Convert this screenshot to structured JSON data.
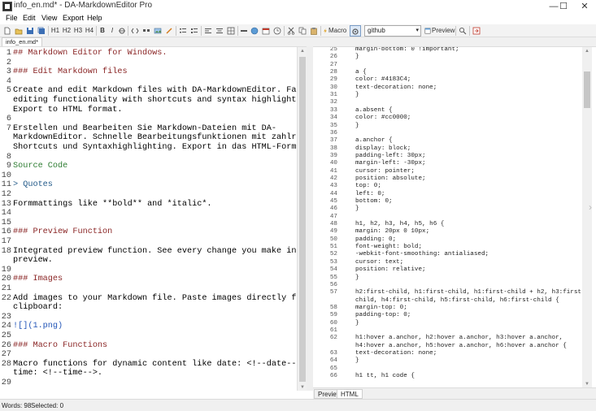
{
  "window": {
    "title": "info_en.md* - DA-MarkdownEditor Pro",
    "minimize": "—",
    "maximize": "☐",
    "close": "✕"
  },
  "menu": [
    "File",
    "Edit",
    "View",
    "Export",
    "Help"
  ],
  "toolbar": {
    "h1": "H1",
    "h2": "H2",
    "h3": "H3",
    "h4": "H4",
    "bold": "B",
    "italic": "I",
    "macro_label": "Macro",
    "style_value": "github",
    "preview_label": "Preview"
  },
  "document_tab": "info_en.md*",
  "editor_lines": [
    {
      "n": "1",
      "t": "## Markdown Editor for Windows.",
      "k": "h"
    },
    {
      "n": "2",
      "t": "",
      "k": ""
    },
    {
      "n": "3",
      "t": "### Edit Markdown files",
      "k": "h"
    },
    {
      "n": "4",
      "t": "",
      "k": ""
    },
    {
      "n": "5",
      "t": "Create and edit Markdown files with DA-MarkdownEditor. Fast",
      "k": ""
    },
    {
      "n": "",
      "t": "editing functionality with shortcuts and syntax highlighting.",
      "k": ""
    },
    {
      "n": "",
      "t": "Export to HTML format.",
      "k": ""
    },
    {
      "n": "6",
      "t": "",
      "k": ""
    },
    {
      "n": "7",
      "t": "Erstellen und Bearbeiten Sie Markdown-Dateien mit DA-",
      "k": ""
    },
    {
      "n": "",
      "t": "MarkdownEditor. Schnelle Bearbeitungsfunktionen mit zahlreichen",
      "k": ""
    },
    {
      "n": "",
      "t": "Shortcuts und Syntaxhighlighting. Export in das HTML-Format.",
      "k": ""
    },
    {
      "n": "8",
      "t": "",
      "k": ""
    },
    {
      "n": "9",
      "t": "    Source Code",
      "k": "src"
    },
    {
      "n": "10",
      "t": "",
      "k": ""
    },
    {
      "n": "11",
      "t": "> Quotes",
      "k": "q"
    },
    {
      "n": "12",
      "t": "",
      "k": ""
    },
    {
      "n": "13",
      "t": "Formmattings like **bold** and *italic*.",
      "k": ""
    },
    {
      "n": "14",
      "t": "",
      "k": ""
    },
    {
      "n": "15",
      "t": "",
      "k": ""
    },
    {
      "n": "16",
      "t": "### Preview Function",
      "k": "h"
    },
    {
      "n": "17",
      "t": "",
      "k": ""
    },
    {
      "n": "18",
      "t": "Integrated preview function. See every change you make in the",
      "k": ""
    },
    {
      "n": "",
      "t": "preview.",
      "k": ""
    },
    {
      "n": "19",
      "t": "",
      "k": ""
    },
    {
      "n": "20",
      "t": "### Images",
      "k": "h"
    },
    {
      "n": "21",
      "t": "",
      "k": ""
    },
    {
      "n": "22",
      "t": "Add images to your Markdown file. Paste images directly from the",
      "k": ""
    },
    {
      "n": "",
      "t": "clipboard:",
      "k": ""
    },
    {
      "n": "23",
      "t": "",
      "k": ""
    },
    {
      "n": "24",
      "t": "![](1.png)",
      "k": "link"
    },
    {
      "n": "25",
      "t": "",
      "k": ""
    },
    {
      "n": "26",
      "t": "### Macro Functions",
      "k": "h"
    },
    {
      "n": "27",
      "t": "",
      "k": ""
    },
    {
      "n": "28",
      "t": "Macro functions for dynamic content like date: <!--date--> or",
      "k": ""
    },
    {
      "n": "",
      "t": "time: <!--time-->.",
      "k": ""
    },
    {
      "n": "29",
      "t": "",
      "k": ""
    }
  ],
  "html_lines": [
    {
      "n": "25",
      "t": "  margin-bottom: 0 !important;"
    },
    {
      "n": "26",
      "t": "}"
    },
    {
      "n": "27",
      "t": ""
    },
    {
      "n": "28",
      "t": "a {"
    },
    {
      "n": "29",
      "t": "  color: #4183C4;"
    },
    {
      "n": "30",
      "t": "  text-decoration: none;"
    },
    {
      "n": "31",
      "t": "}"
    },
    {
      "n": "32",
      "t": ""
    },
    {
      "n": "33",
      "t": "a.absent {"
    },
    {
      "n": "34",
      "t": "  color: #cc0000;"
    },
    {
      "n": "35",
      "t": "}"
    },
    {
      "n": "36",
      "t": ""
    },
    {
      "n": "37",
      "t": "a.anchor {"
    },
    {
      "n": "38",
      "t": "  display: block;"
    },
    {
      "n": "39",
      "t": "  padding-left: 30px;"
    },
    {
      "n": "40",
      "t": "  margin-left: -30px;"
    },
    {
      "n": "41",
      "t": "  cursor: pointer;"
    },
    {
      "n": "42",
      "t": "  position: absolute;"
    },
    {
      "n": "43",
      "t": "  top: 0;"
    },
    {
      "n": "44",
      "t": "  left: 0;"
    },
    {
      "n": "45",
      "t": "  bottom: 0;"
    },
    {
      "n": "46",
      "t": "}"
    },
    {
      "n": "47",
      "t": ""
    },
    {
      "n": "48",
      "t": "h1, h2, h3, h4, h5, h6 {"
    },
    {
      "n": "49",
      "t": "  margin: 20px 0 10px;"
    },
    {
      "n": "50",
      "t": "  padding: 0;"
    },
    {
      "n": "51",
      "t": "  font-weight: bold;"
    },
    {
      "n": "52",
      "t": "  -webkit-font-smoothing: antialiased;"
    },
    {
      "n": "53",
      "t": "  cursor: text;"
    },
    {
      "n": "54",
      "t": "  position: relative;"
    },
    {
      "n": "55",
      "t": "}"
    },
    {
      "n": "56",
      "t": ""
    },
    {
      "n": "57",
      "t": "h2:first-child, h1:first-child, h1:first-child + h2, h3:first-"
    },
    {
      "n": "",
      "t": "child, h4:first-child, h5:first-child, h6:first-child {"
    },
    {
      "n": "58",
      "t": "  margin-top: 0;"
    },
    {
      "n": "59",
      "t": "  padding-top: 0;"
    },
    {
      "n": "60",
      "t": "}"
    },
    {
      "n": "61",
      "t": ""
    },
    {
      "n": "62",
      "t": "h1:hover a.anchor, h2:hover a.anchor, h3:hover a.anchor,"
    },
    {
      "n": "",
      "t": "h4:hover a.anchor, h5:hover a.anchor, h6:hover a.anchor {"
    },
    {
      "n": "63",
      "t": "  text-decoration: none;"
    },
    {
      "n": "64",
      "t": "}"
    },
    {
      "n": "65",
      "t": ""
    },
    {
      "n": "66",
      "t": "h1 tt, h1 code {"
    }
  ],
  "bottom_tabs": [
    "Preview",
    "HTML"
  ],
  "status": {
    "words": "Words:  98",
    "selected": "Selected:  0"
  },
  "colors": {
    "heading": "#8a2525",
    "quote": "#245b8a",
    "source": "#2e7d32",
    "link": "#2456b8",
    "css_number": "#2b4ec2"
  }
}
